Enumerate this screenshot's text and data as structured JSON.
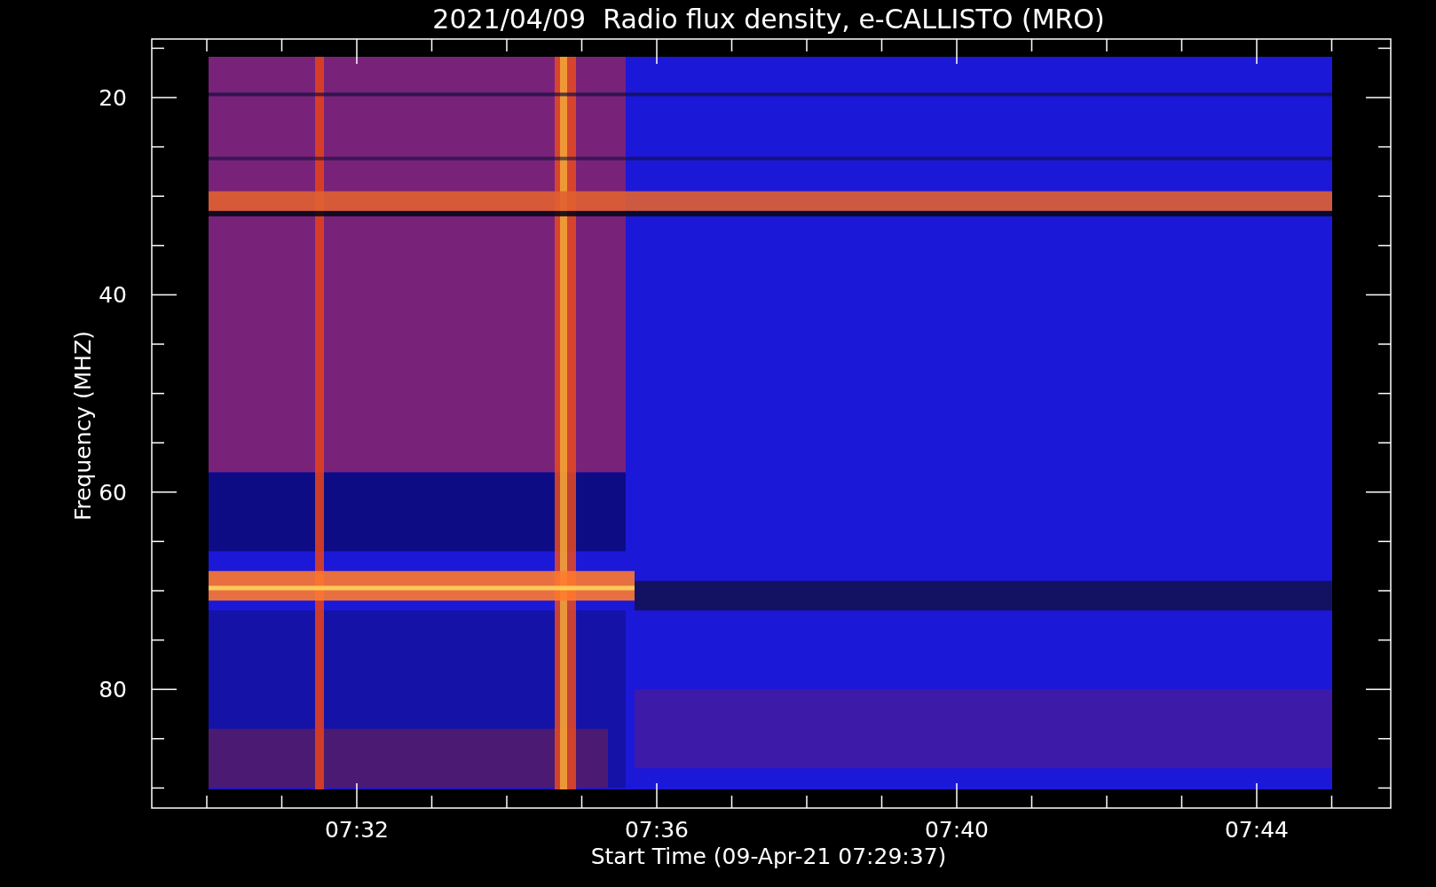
{
  "title": "2021/04/09  Radio flux density, e-CALLISTO (MRO)",
  "y_axis": {
    "label": "Frequency (MHZ)",
    "ticks": [
      "20",
      "40",
      "60",
      "80"
    ]
  },
  "x_axis": {
    "label": "Start Time (09-Apr-21 07:29:37)",
    "ticks": [
      "07:32",
      "07:36",
      "07:40",
      "07:44"
    ]
  }
}
